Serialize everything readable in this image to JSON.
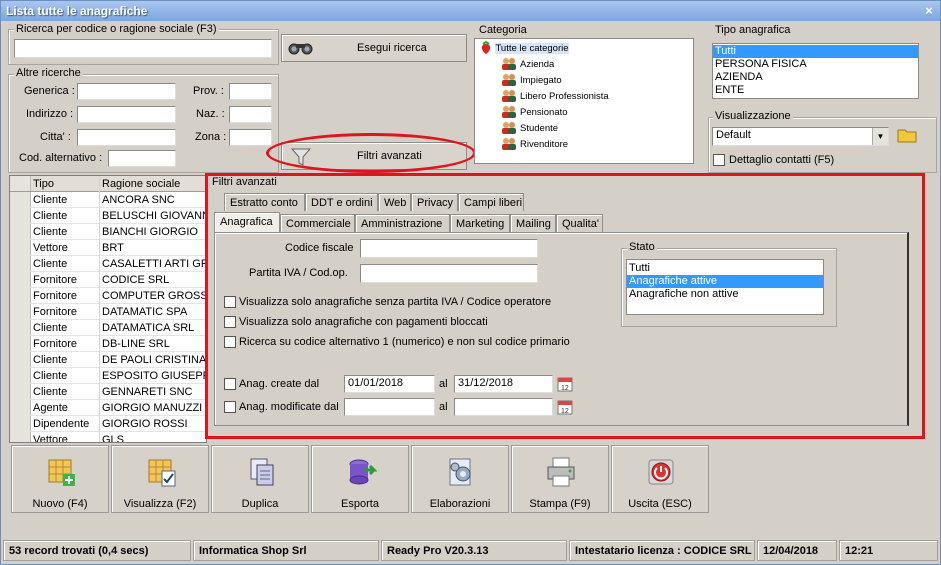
{
  "window": {
    "title": "Lista tutte le anagrafiche",
    "close_label": "×"
  },
  "search": {
    "group_label": "Ricerca per codice o ragione sociale (F3)",
    "value": "",
    "button_label": "Esegui ricerca"
  },
  "altre": {
    "group_label": "Altre ricerche",
    "generica": "Generica :",
    "indirizzo": "Indirizzo :",
    "citta": "Citta' :",
    "cod_alt": "Cod. alternativo :",
    "prov": "Prov. :",
    "naz": "Naz. :",
    "zona": "Zona :"
  },
  "filtri_button": "Filtri avanzati",
  "categoria": {
    "label": "Categoria",
    "root": "Tutte le categorie",
    "items": [
      "Azienda",
      "Impiegato",
      "Libero Professionista",
      "Pensionato",
      "Studente",
      "Rivenditore"
    ]
  },
  "tipo_anagrafica": {
    "label": "Tipo anagrafica",
    "items": [
      "Tutti",
      "PERSONA FISICA",
      "AZIENDA",
      "ENTE"
    ],
    "selected_index": 0
  },
  "visualizzazione": {
    "label": "Visualizzazione",
    "selected": "Default",
    "dettaglio_label": "Dettaglio contatti (F5)"
  },
  "grid": {
    "headers": [
      "Tipo",
      "Ragione sociale"
    ],
    "rows": [
      [
        "Cliente",
        "ANCORA SNC"
      ],
      [
        "Cliente",
        "BELUSCHI GIOVANNI"
      ],
      [
        "Cliente",
        "BIANCHI GIORGIO"
      ],
      [
        "Vettore",
        "BRT"
      ],
      [
        "Cliente",
        "CASALETTI ARTI GRA"
      ],
      [
        "Fornitore",
        "CODICE SRL"
      ],
      [
        "Fornitore",
        "COMPUTER GROSS SP"
      ],
      [
        "Fornitore",
        "DATAMATIC SPA"
      ],
      [
        "Cliente",
        "DATAMATICA SRL"
      ],
      [
        "Fornitore",
        "DB-LINE SRL"
      ],
      [
        "Cliente",
        "DE PAOLI CRISTINA"
      ],
      [
        "Cliente",
        "ESPOSITO GIUSEPPE"
      ],
      [
        "Cliente",
        "GENNARETI SNC"
      ],
      [
        "Agente",
        "GIORGIO MANUZZI (G"
      ],
      [
        "Dipendente",
        "GIORGIO ROSSI"
      ],
      [
        "Vettore",
        "GLS"
      ]
    ]
  },
  "filtri": {
    "title": "Filtri avanzati",
    "tabs_row1": [
      "Estratto conto",
      "DDT e ordini",
      "Web",
      "Privacy",
      "Campi liberi"
    ],
    "tabs_row2": [
      "Anagrafica",
      "Commerciale",
      "Amministrazione",
      "Marketing",
      "Mailing",
      "Qualita'"
    ],
    "codice_fiscale": "Codice fiscale",
    "partita_iva": "Partita IVA / Cod.op.",
    "chk1": "Visualizza solo anagrafiche senza partita IVA / Codice operatore",
    "chk2": "Visualizza solo anagrafiche con pagamenti bloccati",
    "chk3": "Ricerca su codice alternativo 1 (numerico)  e non sul codice primario",
    "create_label": "Anag. create dal",
    "create_from": "01/01/2018",
    "create_to": "31/12/2018",
    "modif_label": "Anag. modificate dal",
    "al": "al",
    "stato": {
      "label": "Stato",
      "items": [
        "Tutti",
        "Anagrafiche attive",
        "Anagrafiche non attive"
      ],
      "selected_index": 1
    }
  },
  "toolbar": [
    {
      "label": "Nuovo (F4)",
      "icon": "new-icon"
    },
    {
      "label": "Visualizza (F2)",
      "icon": "view-icon"
    },
    {
      "label": "Duplica",
      "icon": "duplicate-icon"
    },
    {
      "label": "Esporta",
      "icon": "export-icon"
    },
    {
      "label": "Elaborazioni",
      "icon": "process-icon"
    },
    {
      "label": "Stampa (F9)",
      "icon": "printer-icon"
    },
    {
      "label": "Uscita (ESC)",
      "icon": "exit-icon"
    }
  ],
  "status": {
    "records": "53 record trovati (0,4 secs)",
    "company": "Informatica Shop Srl",
    "version": "Ready Pro V20.3.13",
    "license": "Intestatario licenza : CODICE SRL",
    "date": "12/04/2018",
    "time": "12:21"
  },
  "colors": {
    "highlight_red": "#e0141c",
    "selection": "#3399ff",
    "title_bar": "#7ea5df"
  }
}
